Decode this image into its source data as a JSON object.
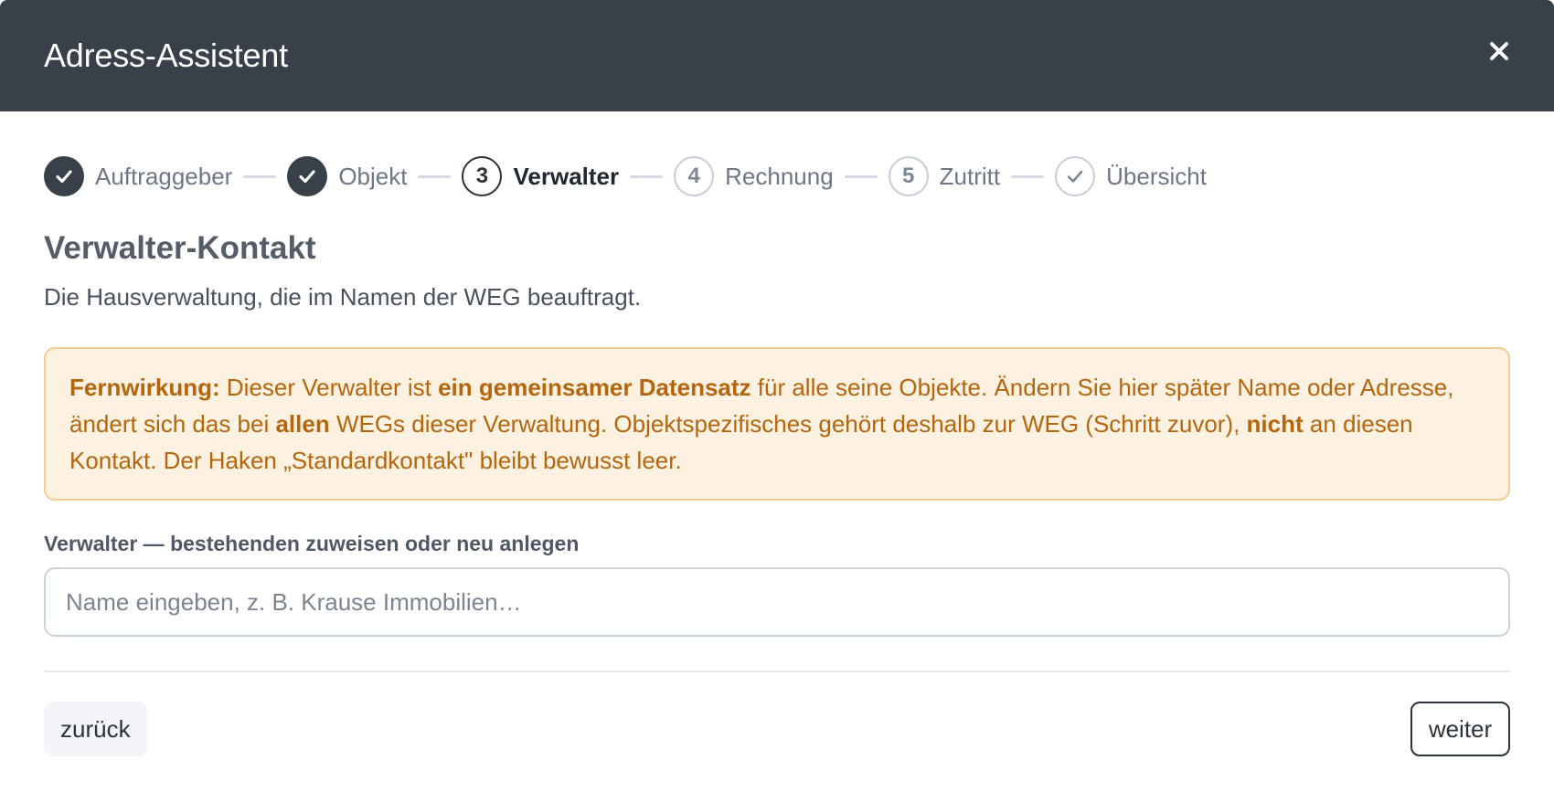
{
  "dialog": {
    "title": "Adress-Assistent",
    "close_icon": "close-icon"
  },
  "stepper": {
    "steps": [
      {
        "label": "Auftraggeber",
        "state": "done",
        "number": "",
        "icon": "check-icon"
      },
      {
        "label": "Objekt",
        "state": "done",
        "number": "",
        "icon": "check-icon"
      },
      {
        "label": "Verwalter",
        "state": "current",
        "number": "3",
        "icon": ""
      },
      {
        "label": "Rechnung",
        "state": "todo",
        "number": "4",
        "icon": ""
      },
      {
        "label": "Zutritt",
        "state": "todo",
        "number": "5",
        "icon": ""
      },
      {
        "label": "Übersicht",
        "state": "todo",
        "number": "",
        "icon": "check-icon"
      }
    ]
  },
  "section": {
    "title": "Verwalter-Kontakt",
    "subtitle": "Die Hausverwaltung, die im Namen der WEG beauftragt."
  },
  "alert": {
    "lead": "Fernwirkung:",
    "text1": " Dieser Verwalter ist ",
    "bold1": "ein gemeinsamer Datensatz",
    "text2": " für alle seine Objekte. Ändern Sie hier später Name oder Adresse, ändert sich das bei ",
    "bold2": "allen",
    "text3": " WEGs dieser Verwaltung. Objektspezifisches gehört deshalb zur WEG (Schritt zuvor), ",
    "bold3": "nicht",
    "text4": " an diesen Kontakt. Der Haken „Standardkontakt\" bleibt bewusst leer."
  },
  "field": {
    "label": "Verwalter — bestehenden zuweisen oder neu anlegen",
    "value": "",
    "placeholder": "Name eingeben, z. B. Krause Immobilien…"
  },
  "footer": {
    "back_label": "zurück",
    "next_label": "weiter"
  },
  "colors": {
    "header_bg": "#38414a",
    "alert_bg": "#fdf1e2",
    "alert_border": "#f3cd8c",
    "alert_text": "#b5650c"
  }
}
